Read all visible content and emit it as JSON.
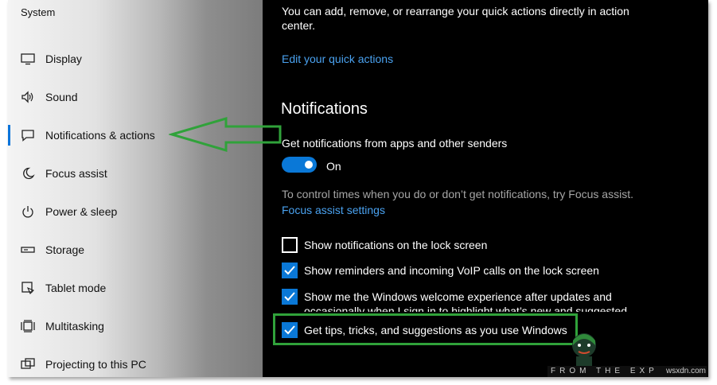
{
  "sidebar": {
    "title": "System",
    "items": [
      {
        "label": "Display",
        "icon": "display-icon"
      },
      {
        "label": "Sound",
        "icon": "speaker-icon"
      },
      {
        "label": "Notifications & actions",
        "icon": "notification-icon",
        "active": true
      },
      {
        "label": "Focus assist",
        "icon": "moon-icon"
      },
      {
        "label": "Power & sleep",
        "icon": "power-icon"
      },
      {
        "label": "Storage",
        "icon": "storage-icon"
      },
      {
        "label": "Tablet mode",
        "icon": "tablet-mode-icon"
      },
      {
        "label": "Multitasking",
        "icon": "multitasking-icon"
      },
      {
        "label": "Projecting to this PC",
        "icon": "projecting-icon"
      }
    ]
  },
  "main": {
    "intro_line1": "You can add, remove, or rearrange your quick actions directly in action",
    "intro_line2": "center.",
    "edit_link": "Edit your quick actions",
    "notifications_heading": "Notifications",
    "get_notifications_label": "Get notifications from apps and other senders",
    "toggle_state": "On",
    "focus_hint": "To control times when you do or don’t get notifications, try Focus assist.",
    "focus_link": "Focus assist settings",
    "options": [
      {
        "label": "Show notifications on the lock screen",
        "checked": false
      },
      {
        "label": "Show reminders and incoming VoIP calls on the lock screen",
        "checked": true
      },
      {
        "label_line1": "Show me the Windows welcome experience after updates and",
        "label_line2": "occasionally when I sign in to highlight what’s new and suggested",
        "checked": true
      },
      {
        "label": "Get tips, tricks, and suggestions as you use Windows",
        "checked": true
      }
    ]
  },
  "watermark": {
    "text": "FROM THE EXP",
    "site": "wsxdn.com"
  },
  "colors": {
    "accent": "#0a78d7",
    "link": "#4aa2f0",
    "annotation_green": "#30a23a"
  }
}
